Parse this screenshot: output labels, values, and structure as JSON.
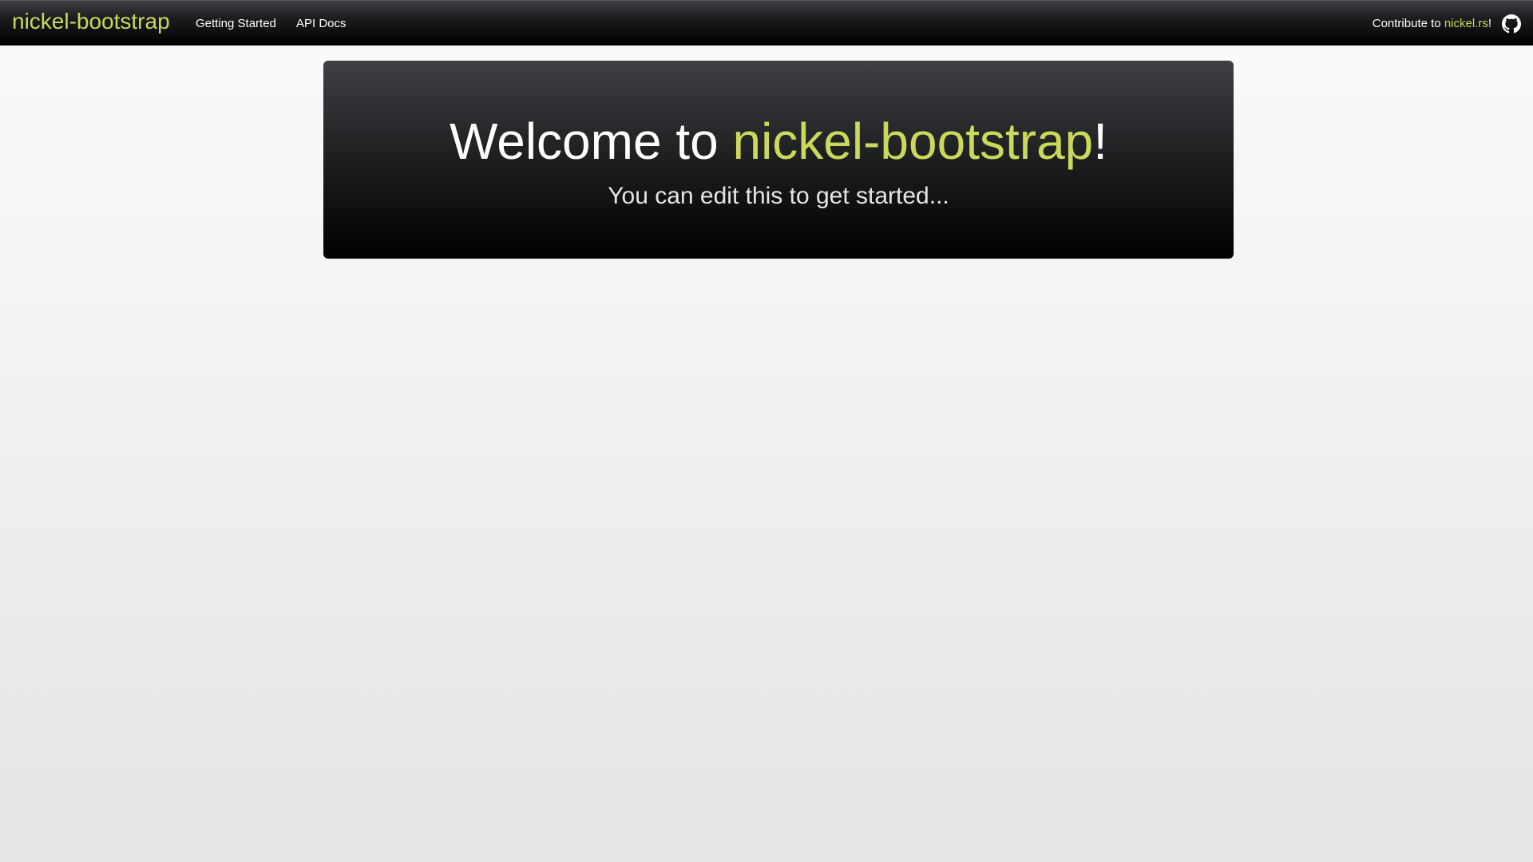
{
  "navbar": {
    "brand": "nickel-bootstrap",
    "links": [
      {
        "label": "Getting Started"
      },
      {
        "label": "API Docs"
      }
    ],
    "contribute_prefix": "Contribute to ",
    "contribute_link": "nickel.rs",
    "contribute_suffix": "!",
    "github_icon": "github-icon"
  },
  "jumbotron": {
    "title_prefix": "Welcome to ",
    "title_accent": "nickel-bootstrap",
    "title_suffix": "!",
    "subtitle": "You can edit this to get started..."
  },
  "colors": {
    "accent": "#ccd85a",
    "navbar_bg": "#000000",
    "text_light": "#ffffff"
  }
}
